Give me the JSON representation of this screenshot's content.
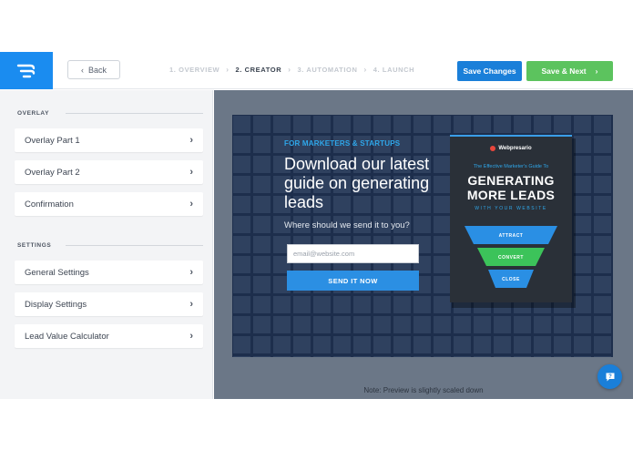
{
  "topbar": {
    "back_label": "Back",
    "steps": [
      "1. OVERVIEW",
      "2. CREATOR",
      "3. AUTOMATION",
      "4. LAUNCH"
    ],
    "active_step": 1,
    "save_changes_label": "Save Changes",
    "save_next_label": "Save & Next"
  },
  "sidebar": {
    "overlay_section": "OVERLAY",
    "overlay_items": [
      {
        "label": "Overlay Part 1"
      },
      {
        "label": "Overlay Part 2"
      },
      {
        "label": "Confirmation"
      }
    ],
    "settings_section": "SETTINGS",
    "settings_items": [
      {
        "label": "General Settings"
      },
      {
        "label": "Display Settings"
      },
      {
        "label": "Lead Value Calculator"
      }
    ]
  },
  "preview": {
    "note": "Note: Preview is slightly scaled down",
    "popup": {
      "eyebrow": "FOR MARKETERS & STARTUPS",
      "headline": "Download our latest guide on generating leads",
      "subline": "Where should we send it to you?",
      "email_placeholder": "email@website.com",
      "send_label": "SEND IT NOW",
      "book": {
        "brand": "Webpresario",
        "kicker": "The Effective Marketer's Guide To",
        "title_line1": "GENERATING",
        "title_line2": "MORE LEADS",
        "subtitle": "WITH YOUR WEBSITE",
        "funnel": [
          "ATTRACT",
          "CONVERT",
          "CLOSE"
        ]
      }
    }
  },
  "colors": {
    "brand_blue": "#1a8cf0",
    "save_changes": "#1a7fd9",
    "save_next": "#5cc35e",
    "popup_bg": "#1d2e4c",
    "accent_cyan": "#2fa7ea"
  }
}
